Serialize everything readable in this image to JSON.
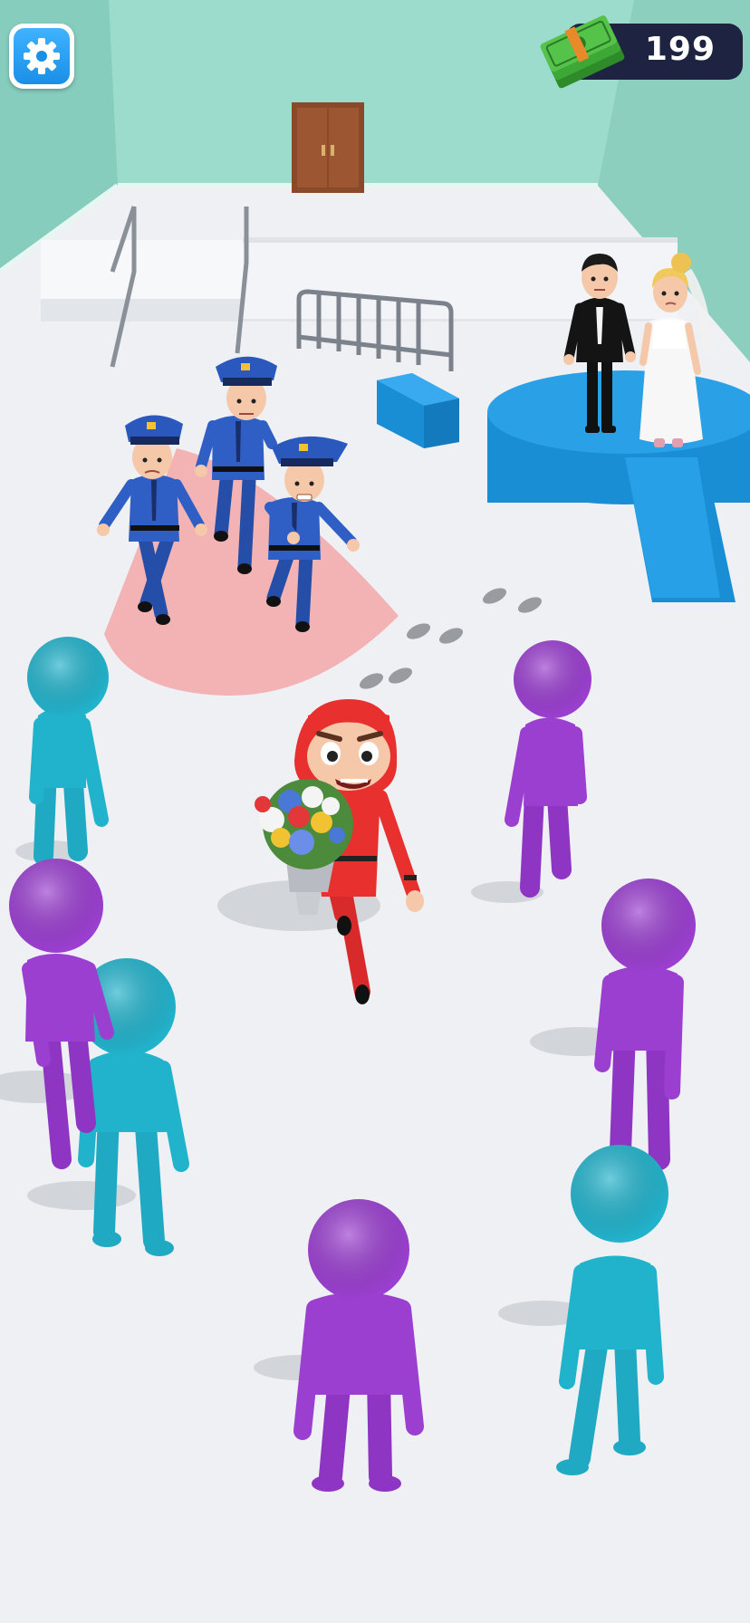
{
  "hud": {
    "settings_icon": "gear-icon",
    "cash_icon": "cash-stack-icon",
    "money": "199"
  },
  "colors": {
    "wall": "#93d6c6",
    "floor": "#eef0f3",
    "platform": "#1f93d6",
    "police": "#2f5fc4",
    "player": "#e8302e",
    "cyan_crowd": "#22b3cc",
    "purple_crowd": "#9b3fd0",
    "vision_cone": "#f3a8a8",
    "hud_dark": "#1d2340",
    "settings_blue": "#1a8fe6"
  }
}
